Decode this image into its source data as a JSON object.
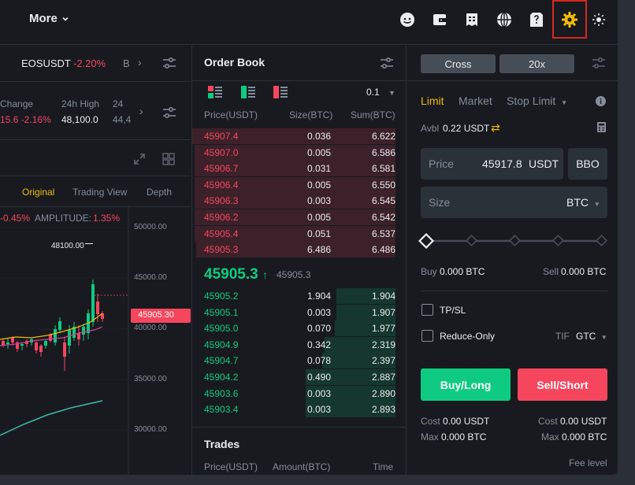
{
  "topbar": {
    "more_label": "More",
    "icons": [
      "user-icon",
      "wallet-icon",
      "orders-icon",
      "globe-icon",
      "download-icon",
      "gear-icon",
      "theme-icon"
    ]
  },
  "left": {
    "ticker_pair": "EOSUSDT",
    "ticker_change": "-2.20%",
    "ticker_next": "B",
    "stats": {
      "change_label": "Change",
      "change_value": "15.6 -2.16%",
      "high_label": "24h High",
      "high_value": "48,100.0",
      "next_label": "24",
      "next_value": "44,4"
    },
    "views": [
      "Original",
      "Trading View",
      "Depth"
    ],
    "chart_info": {
      "change": "-0.45%",
      "amplitude_label": "AMPLITUDE:",
      "amplitude_value": "1.35%"
    },
    "peak_label": "48100.00",
    "price_tag": "45905.30",
    "axis": [
      "50000.00",
      "45000.00",
      "40000.00",
      "35000.00",
      "30000.00"
    ]
  },
  "orderbook": {
    "title": "Order Book",
    "precision": "0.1",
    "headers": {
      "price": "Price(USDT)",
      "size": "Size(BTC)",
      "sum": "Sum(BTC)"
    },
    "asks": [
      {
        "price": "45907.4",
        "size": "0.036",
        "sum": "6.622",
        "depth": 1.0
      },
      {
        "price": "45907.0",
        "size": "0.005",
        "sum": "6.586",
        "depth": 0.99
      },
      {
        "price": "45906.7",
        "size": "0.031",
        "sum": "6.581",
        "depth": 0.99
      },
      {
        "price": "45906.4",
        "size": "0.005",
        "sum": "6.550",
        "depth": 0.99
      },
      {
        "price": "45906.3",
        "size": "0.003",
        "sum": "6.545",
        "depth": 0.99
      },
      {
        "price": "45906.2",
        "size": "0.005",
        "sum": "6.542",
        "depth": 0.99
      },
      {
        "price": "45905.4",
        "size": "0.051",
        "sum": "6.537",
        "depth": 0.99
      },
      {
        "price": "45905.3",
        "size": "6.486",
        "sum": "6.486",
        "depth": 0.98
      }
    ],
    "last_price": "45905.3",
    "mark_price": "45905.3",
    "bids": [
      {
        "price": "45905.2",
        "size": "1.904",
        "sum": "1.904",
        "depth": 0.29
      },
      {
        "price": "45905.1",
        "size": "0.003",
        "sum": "1.907",
        "depth": 0.29
      },
      {
        "price": "45905.0",
        "size": "0.070",
        "sum": "1.977",
        "depth": 0.3
      },
      {
        "price": "45904.9",
        "size": "0.342",
        "sum": "2.319",
        "depth": 0.35
      },
      {
        "price": "45904.7",
        "size": "0.078",
        "sum": "2.397",
        "depth": 0.36
      },
      {
        "price": "45904.2",
        "size": "0.490",
        "sum": "2.887",
        "depth": 0.44
      },
      {
        "price": "45903.6",
        "size": "0.003",
        "sum": "2.890",
        "depth": 0.44
      },
      {
        "price": "45903.4",
        "size": "0.003",
        "sum": "2.893",
        "depth": 0.44
      }
    ],
    "trades_title": "Trades",
    "trades_headers": {
      "price": "Price(USDT)",
      "amount": "Amount(BTC)",
      "time": "Time"
    }
  },
  "order_form": {
    "margin_mode": "Cross",
    "leverage": "20x",
    "tabs": [
      "Limit",
      "Market",
      "Stop Limit"
    ],
    "avbl_label": "Avbl",
    "avbl_value": "0.22 USDT",
    "price_label": "Price",
    "price_value": "45917.8",
    "price_unit": "USDT",
    "bbo_label": "BBO",
    "size_label": "Size",
    "size_unit": "BTC",
    "slider_level": 0,
    "buy_label": "Buy",
    "buy_value": "0.000 BTC",
    "sell_label": "Sell",
    "sell_value": "0.000 BTC",
    "tpsl_label": "TP/SL",
    "reduce_label": "Reduce-Only",
    "tif_label": "TIF",
    "tif_value": "GTC",
    "buy_button": "Buy/Long",
    "sell_button": "Sell/Short",
    "cost_label": "Cost",
    "cost_buy": "0.00 USDT",
    "cost_sell": "0.00 USDT",
    "max_label": "Max",
    "max_buy": "0.000 BTC",
    "max_sell": "0.000 BTC",
    "fee_level": "Fee level"
  },
  "colors": {
    "bg": "#181a20",
    "ask": "#f6465d",
    "bid": "#0ecb81",
    "accent": "#f0b90b",
    "highlight_box": "#d9281e"
  }
}
